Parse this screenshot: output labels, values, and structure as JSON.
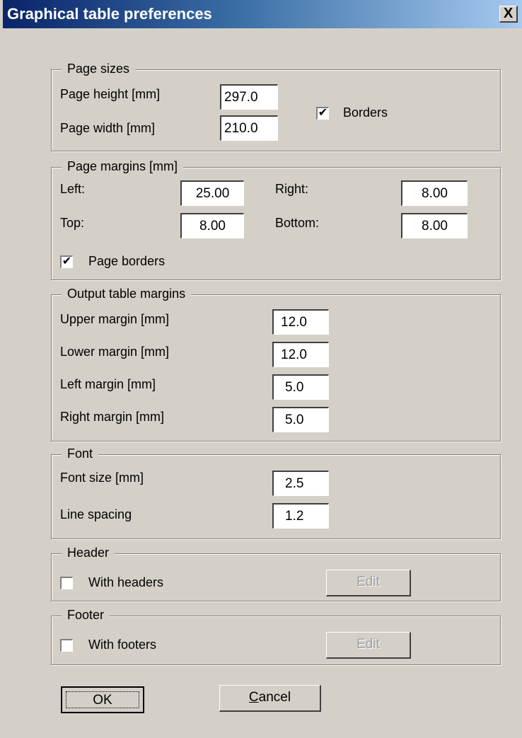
{
  "window": {
    "title": "Graphical table preferences",
    "close_label": "X"
  },
  "page_sizes": {
    "legend": "Page sizes",
    "height_label": "Page height [mm]",
    "height_value": "297.0",
    "width_label": "Page width [mm]",
    "width_value": "210.0",
    "borders_label": "Borders",
    "borders_checked": true
  },
  "page_margins": {
    "legend": "Page margins [mm]",
    "left_label": "Left:",
    "left_value": "25.00",
    "right_label": "Right:",
    "right_value": "8.00",
    "top_label": "Top:",
    "top_value": "8.00",
    "bottom_label": "Bottom:",
    "bottom_value": "8.00",
    "page_borders_label": "Page borders",
    "page_borders_checked": true
  },
  "output_margins": {
    "legend": "Output table margins",
    "upper_label": "Upper margin [mm]",
    "upper_value": "12.0",
    "lower_label": "Lower margin [mm]",
    "lower_value": "12.0",
    "left_label": "Left margin [mm]",
    "left_value": "5.0",
    "right_label": "Right margin [mm]",
    "right_value": "5.0"
  },
  "font": {
    "legend": "Font",
    "size_label": "Font size [mm]",
    "size_value": "2.5",
    "spacing_label": "Line spacing",
    "spacing_value": "1.2"
  },
  "header": {
    "legend": "Header",
    "checkbox_label": "With headers",
    "checked": false,
    "edit_label": "Edit"
  },
  "footer": {
    "legend": "Footer",
    "checkbox_label": "With footers",
    "checked": false,
    "edit_label": "Edit"
  },
  "buttons": {
    "ok_label": "OK",
    "cancel_rest": "ancel",
    "cancel_mnemonic": "C"
  }
}
